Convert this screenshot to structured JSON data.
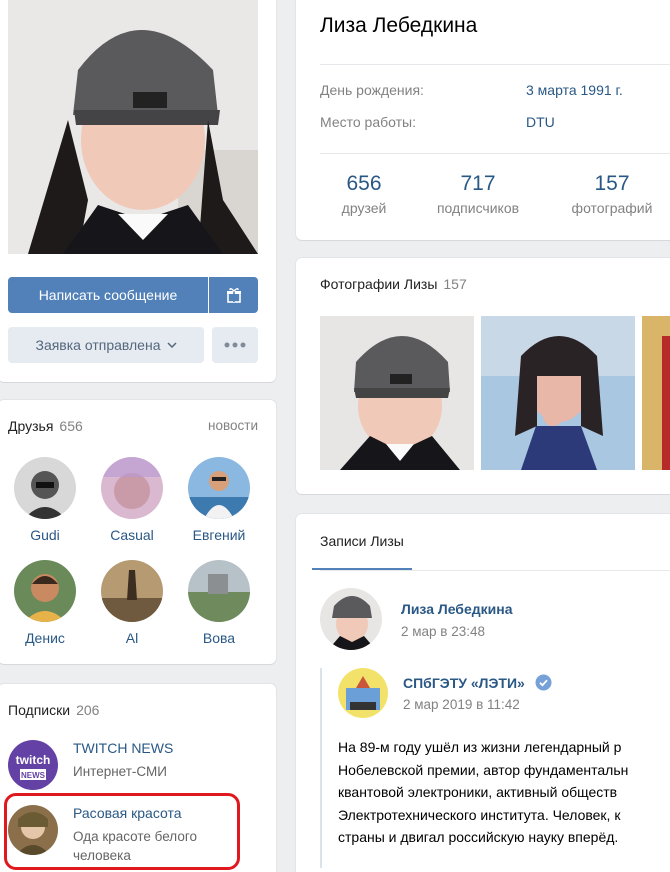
{
  "profile": {
    "name": "Лиза Лебедкина",
    "write_button": "Написать сообщение",
    "request_button": "Заявка отправлена",
    "birthday_label": "День рождения:",
    "birthday_value": "3 марта 1991 г.",
    "work_label": "Место работы:",
    "work_value": "DTU",
    "icons": {
      "gift": "gift-icon",
      "more": "more-dots-icon",
      "chevron": "chevron-down-icon"
    }
  },
  "counters": [
    {
      "num": "656",
      "label": "друзей"
    },
    {
      "num": "717",
      "label": "подписчиков"
    },
    {
      "num": "157",
      "label": "фотографий"
    }
  ],
  "friends": {
    "title": "Друзья",
    "count": "656",
    "news_link": "новости",
    "items": [
      "Gudi",
      "Casual",
      "Евгений",
      "Денис",
      "Al",
      "Вова"
    ]
  },
  "subscriptions": {
    "title": "Подписки",
    "count": "206",
    "items": [
      {
        "name": "TWITCH NEWS",
        "desc": "Интернет-СМИ"
      },
      {
        "name": "Расовая красота",
        "desc": "Ода красоте белого человека"
      }
    ]
  },
  "photos": {
    "title": "Фотографии Лизы",
    "count": "157"
  },
  "wall": {
    "tab": "Записи Лизы",
    "author": "Лиза Лебедкина",
    "date": "2 мар в 23:48",
    "repost_author": "СПбГЭТУ «ЛЭТИ»",
    "repost_date": "2 мар 2019 в 11:42",
    "text_lines": [
      "На 89-м году ушёл из жизни легендарный р",
      "Нобелевской премии, автор фундаментальн",
      "квантовой электроники, активный обществ",
      "Электротехнического института. Человек, к",
      "страны и двигал российскую науку вперёд."
    ]
  },
  "colors": {
    "accent": "#5181b8",
    "link": "#2a5885",
    "highlight": "#e0191f"
  }
}
